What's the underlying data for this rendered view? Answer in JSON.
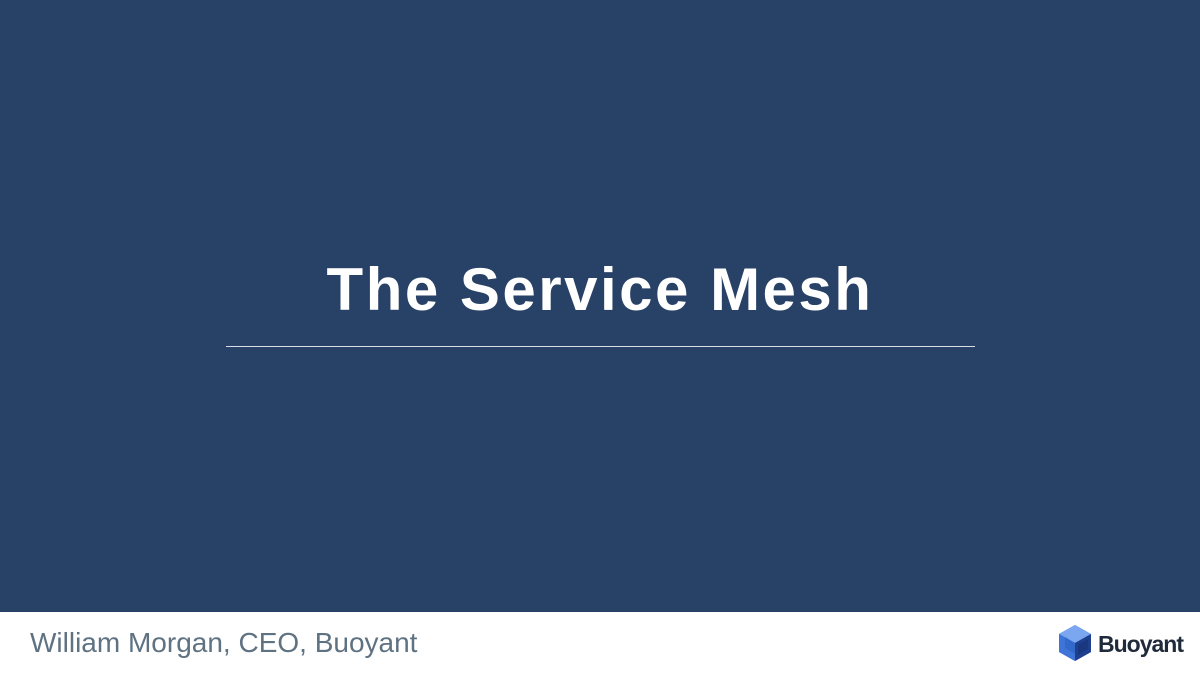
{
  "slide": {
    "title": "The Service Mesh",
    "presenter": "William Morgan, CEO, Buoyant"
  },
  "logo": {
    "icon": "cube-logo-icon",
    "wordmark": "Buoyant"
  },
  "colors": {
    "background": "#284166",
    "title_text": "#ffffff",
    "divider": "#d9dee6",
    "footer_background": "#ffffff",
    "presenter_text": "#5f7282",
    "logo_light_blue": "#4a7fd6",
    "logo_dark_blue": "#1f3f8f"
  }
}
